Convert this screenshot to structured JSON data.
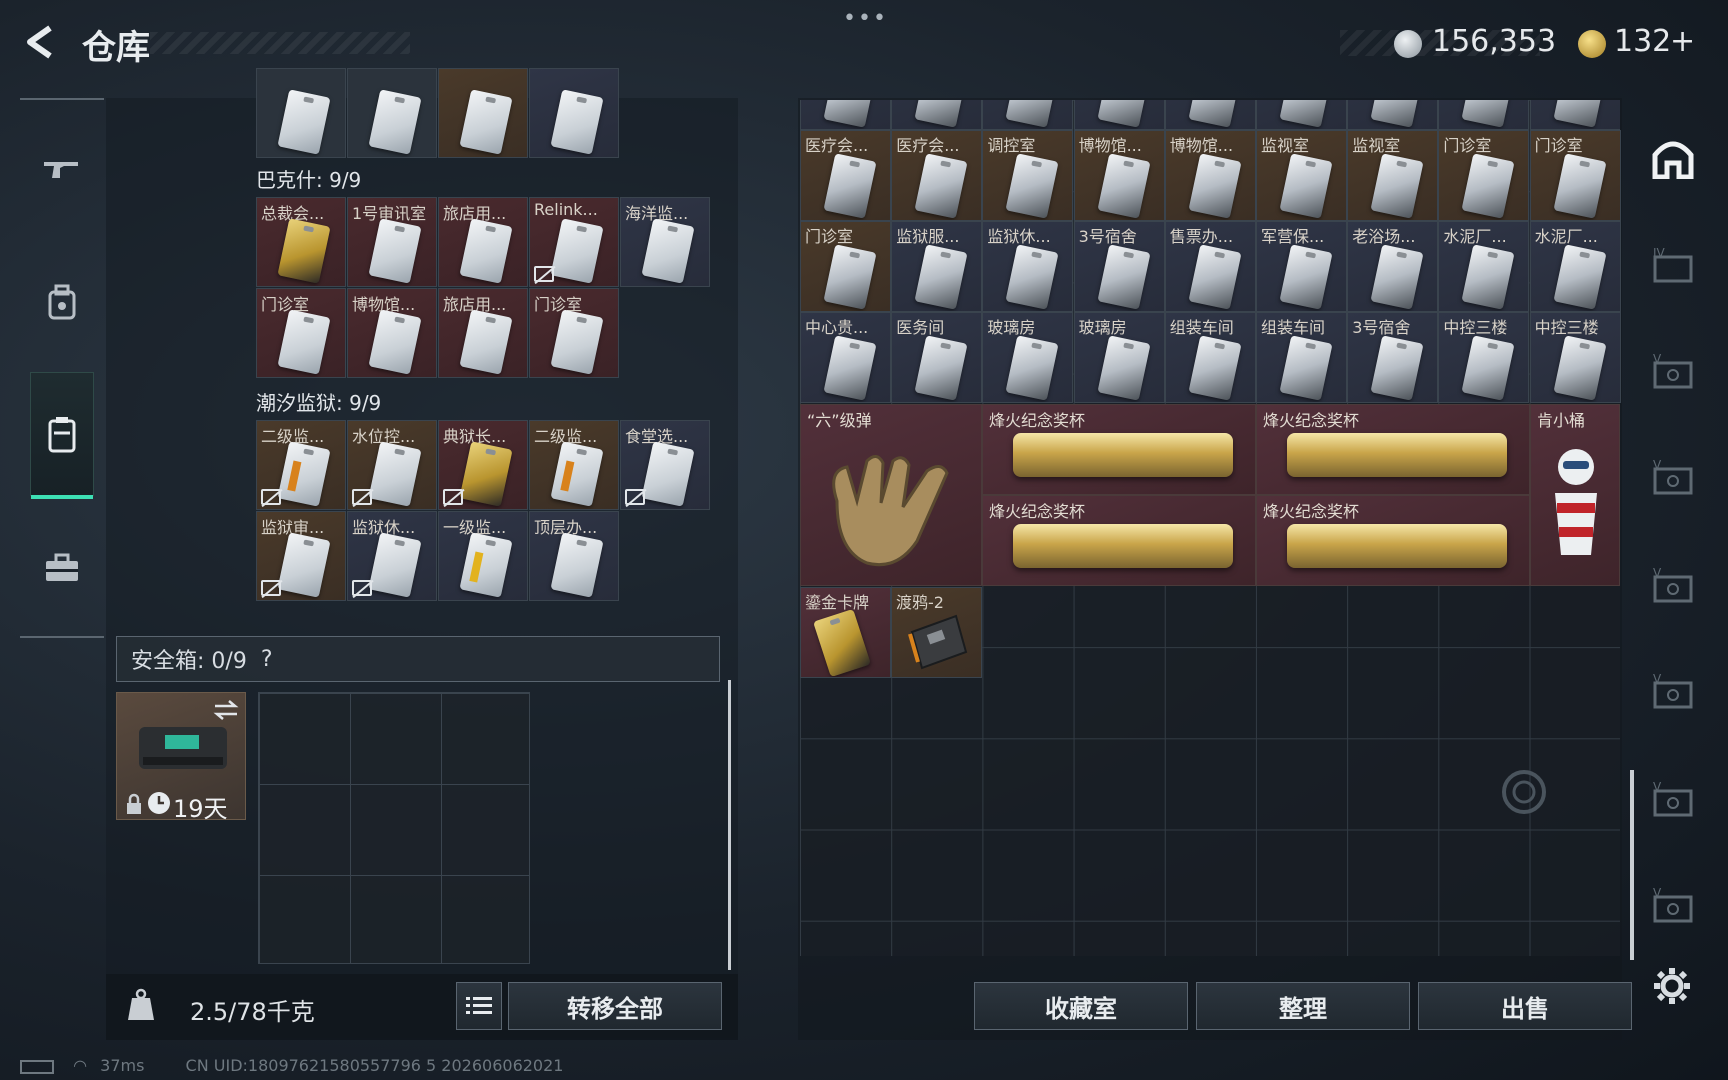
{
  "header": {
    "title": "仓库",
    "menu_dots": "•••",
    "currency1": "156,353",
    "currency2": "132",
    "currency2_plus": "+"
  },
  "left_nav": {
    "items": [
      "gun-icon",
      "backpack-icon",
      "vest-icon",
      "toolbox-icon"
    ],
    "active_index": 2,
    "accent_color": "#3de0b4"
  },
  "sections": {
    "section1_label": "巴克什: 9/9",
    "section2_label": "潮汐监狱: 9/9"
  },
  "baxi_keys": [
    {
      "label": "总裁会...",
      "bg": "red",
      "card": "goldc",
      "noshare": false
    },
    {
      "label": "1号审讯室",
      "bg": "red",
      "card": "normal",
      "noshare": false
    },
    {
      "label": "旅店用...",
      "bg": "red",
      "card": "normal",
      "noshare": false
    },
    {
      "label": "Relink...",
      "bg": "red",
      "card": "normal",
      "noshare": true
    },
    {
      "label": "海洋监...",
      "bg": "blue",
      "card": "normal",
      "noshare": false
    },
    {
      "label": "门诊室",
      "bg": "red",
      "card": "normal",
      "noshare": false
    },
    {
      "label": "博物馆...",
      "bg": "red",
      "card": "normal",
      "noshare": false
    },
    {
      "label": "旅店用...",
      "bg": "red",
      "card": "normal",
      "noshare": false
    },
    {
      "label": "门诊室",
      "bg": "red",
      "card": "normal",
      "noshare": false
    }
  ],
  "prison_keys": [
    {
      "label": "二级监...",
      "bg": "gold",
      "card": "orange",
      "noshare": true
    },
    {
      "label": "水位控...",
      "bg": "gold",
      "card": "normal",
      "noshare": true
    },
    {
      "label": "典狱长...",
      "bg": "red",
      "card": "goldc",
      "noshare": true
    },
    {
      "label": "二级监...",
      "bg": "gold",
      "card": "orange",
      "noshare": false
    },
    {
      "label": "食堂选...",
      "bg": "blue",
      "card": "normal",
      "noshare": true
    },
    {
      "label": "监狱审...",
      "bg": "gold",
      "card": "normal",
      "noshare": true
    },
    {
      "label": "监狱休...",
      "bg": "blue",
      "card": "normal",
      "noshare": true
    },
    {
      "label": "一级监...",
      "bg": "blue",
      "card": "yellow",
      "noshare": false
    },
    {
      "label": "顶层办...",
      "bg": "blue",
      "card": "normal",
      "noshare": false
    }
  ],
  "safebox": {
    "label": "安全箱: 0/9",
    "help": "?",
    "timer": "19天"
  },
  "footer_left": {
    "weight": "2.5/78千克",
    "transfer_all": "转移全部"
  },
  "stash_row1": [
    {
      "label": "医疗会...",
      "bg": "gold"
    },
    {
      "label": "医疗会...",
      "bg": "gold"
    },
    {
      "label": "调控室",
      "bg": "gold"
    },
    {
      "label": "博物馆...",
      "bg": "gold"
    },
    {
      "label": "博物馆...",
      "bg": "gold"
    },
    {
      "label": "监视室",
      "bg": "gold"
    },
    {
      "label": "监视室",
      "bg": "gold"
    },
    {
      "label": "门诊室",
      "bg": "gold"
    },
    {
      "label": "门诊室",
      "bg": "gold"
    }
  ],
  "stash_row2": [
    {
      "label": "门诊室",
      "bg": "gold"
    },
    {
      "label": "监狱服...",
      "bg": "blue"
    },
    {
      "label": "监狱休...",
      "bg": "blue"
    },
    {
      "label": "3号宿舍",
      "bg": "blue"
    },
    {
      "label": "售票办...",
      "bg": "blue"
    },
    {
      "label": "军营保...",
      "bg": "blue"
    },
    {
      "label": "老浴场...",
      "bg": "blue"
    },
    {
      "label": "水泥厂...",
      "bg": "blue"
    },
    {
      "label": "水泥厂...",
      "bg": "blue"
    }
  ],
  "stash_row3": [
    {
      "label": "中心贵...",
      "bg": "blue"
    },
    {
      "label": "医务间",
      "bg": "blue"
    },
    {
      "label": "玻璃房",
      "bg": "blue"
    },
    {
      "label": "玻璃房",
      "bg": "blue"
    },
    {
      "label": "组装车间",
      "bg": "blue"
    },
    {
      "label": "组装车间",
      "bg": "blue"
    },
    {
      "label": "3号宿舍",
      "bg": "blue"
    },
    {
      "label": "中控三楼",
      "bg": "blue"
    },
    {
      "label": "中控三楼",
      "bg": "blue"
    }
  ],
  "special_items": {
    "six_bullet": "“六”级弹",
    "trophy1": "烽火纪念奖杯",
    "trophy2": "烽火纪念奖杯",
    "trophy3": "烽火纪念奖杯",
    "trophy4": "烽火纪念奖杯",
    "kfc_bucket": "肯小桶",
    "gold_card": "鎏金卡牌",
    "raven": "渡鸦-2"
  },
  "footer_right": {
    "collection": "收藏室",
    "sort": "整理",
    "sell": "出售"
  },
  "right_nav": {
    "icons": [
      "home-icon",
      "case-iv-icon",
      "case-v-icon",
      "case-v-icon",
      "case-v-icon",
      "case-v-icon",
      "case-v-icon",
      "case-v-icon"
    ],
    "settings": "gear-icon"
  },
  "status": {
    "ping": "37ms",
    "uid": "CN UID:18097621580557796 5 202606062021"
  }
}
